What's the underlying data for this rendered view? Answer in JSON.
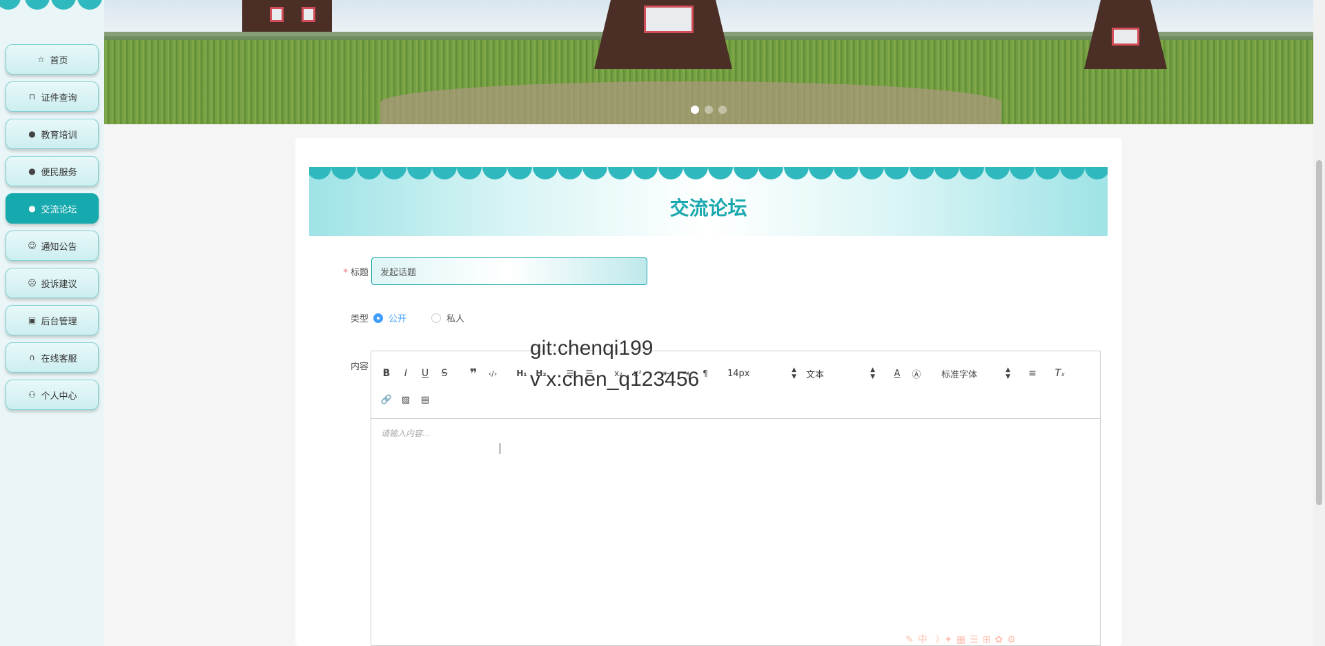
{
  "sidebar": {
    "items": [
      {
        "label": "首页",
        "icon": "star-icon",
        "active": false
      },
      {
        "label": "证件查询",
        "icon": "bag-icon",
        "active": false
      },
      {
        "label": "教育培训",
        "icon": "alert-icon",
        "active": false
      },
      {
        "label": "便民服务",
        "icon": "question-icon",
        "active": false
      },
      {
        "label": "交流论坛",
        "icon": "info-icon",
        "active": true
      },
      {
        "label": "通知公告",
        "icon": "smile-icon",
        "active": false
      },
      {
        "label": "投诉建议",
        "icon": "face-icon",
        "active": false
      },
      {
        "label": "后台管理",
        "icon": "briefcase-icon",
        "active": false
      },
      {
        "label": "在线客服",
        "icon": "headset-icon",
        "active": false
      },
      {
        "label": "个人中心",
        "icon": "user-icon",
        "active": false
      }
    ]
  },
  "banner": {
    "slides": 3,
    "active_slide": 1
  },
  "page": {
    "title": "交流论坛"
  },
  "form": {
    "title_label": "标题",
    "title_value": "发起话题",
    "type_label": "类型",
    "type_options": [
      "公开",
      "私人"
    ],
    "type_selected": "公开",
    "content_label": "内容"
  },
  "editor": {
    "font_size": "14px",
    "header_select": "文本",
    "font_family": "标准字体",
    "placeholder": "请输入内容..."
  },
  "watermark": {
    "line1": "git:chenqi199",
    "line2": "v x:chen_q123456"
  },
  "colors": {
    "accent": "#19a8ae",
    "active_nav": "#16a9ae",
    "radio_checked": "#409eff",
    "required": "#f56c6c"
  }
}
